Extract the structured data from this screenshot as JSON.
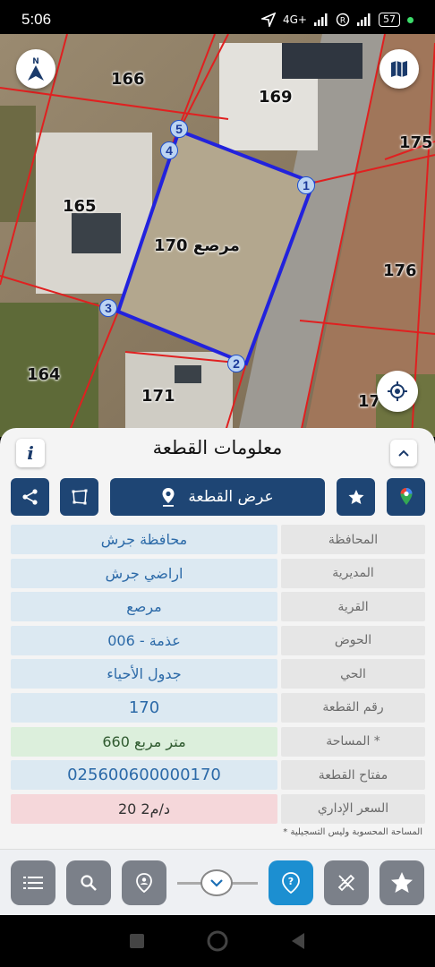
{
  "status_bar": {
    "time": "5:06",
    "network": "4G+",
    "battery": "57"
  },
  "map": {
    "parcel_labels": [
      "166",
      "169",
      "175",
      "165",
      "176",
      "164",
      "171",
      "17"
    ],
    "selected_parcel_label": "مرصع 170",
    "vertices": [
      "1",
      "2",
      "3",
      "4",
      "5"
    ],
    "buttons": {
      "north": "N"
    },
    "colors": {
      "boundary": "#2222dd",
      "parcel_lines": "#e02020"
    }
  },
  "panel": {
    "title": "معلومات القطعة",
    "info_label": "i",
    "show_parcel_label": "عرض القطعة",
    "rows": [
      {
        "key": "المحافظة",
        "value": "محافظة جرش"
      },
      {
        "key": "المديرية",
        "value": "اراضي جرش"
      },
      {
        "key": "القرية",
        "value": "مرصع"
      },
      {
        "key": "الحوض",
        "value": "عذمة - 006"
      },
      {
        "key": "الحي",
        "value": "جدول الأحياء"
      },
      {
        "key": "رقم القطعة",
        "value": "170"
      },
      {
        "key": "المساحة *",
        "value": "660  متر مربع"
      },
      {
        "key": "مفتاح القطعة",
        "value": "025600600000170"
      },
      {
        "key": "السعر الإداري",
        "value": "20 د/م2"
      }
    ],
    "note": "* المساحة المحسوبة وليس التسجيلية"
  },
  "colors": {
    "accent": "#1e4574",
    "active_tool": "#1c8fd1",
    "tool": "#7b8089"
  }
}
